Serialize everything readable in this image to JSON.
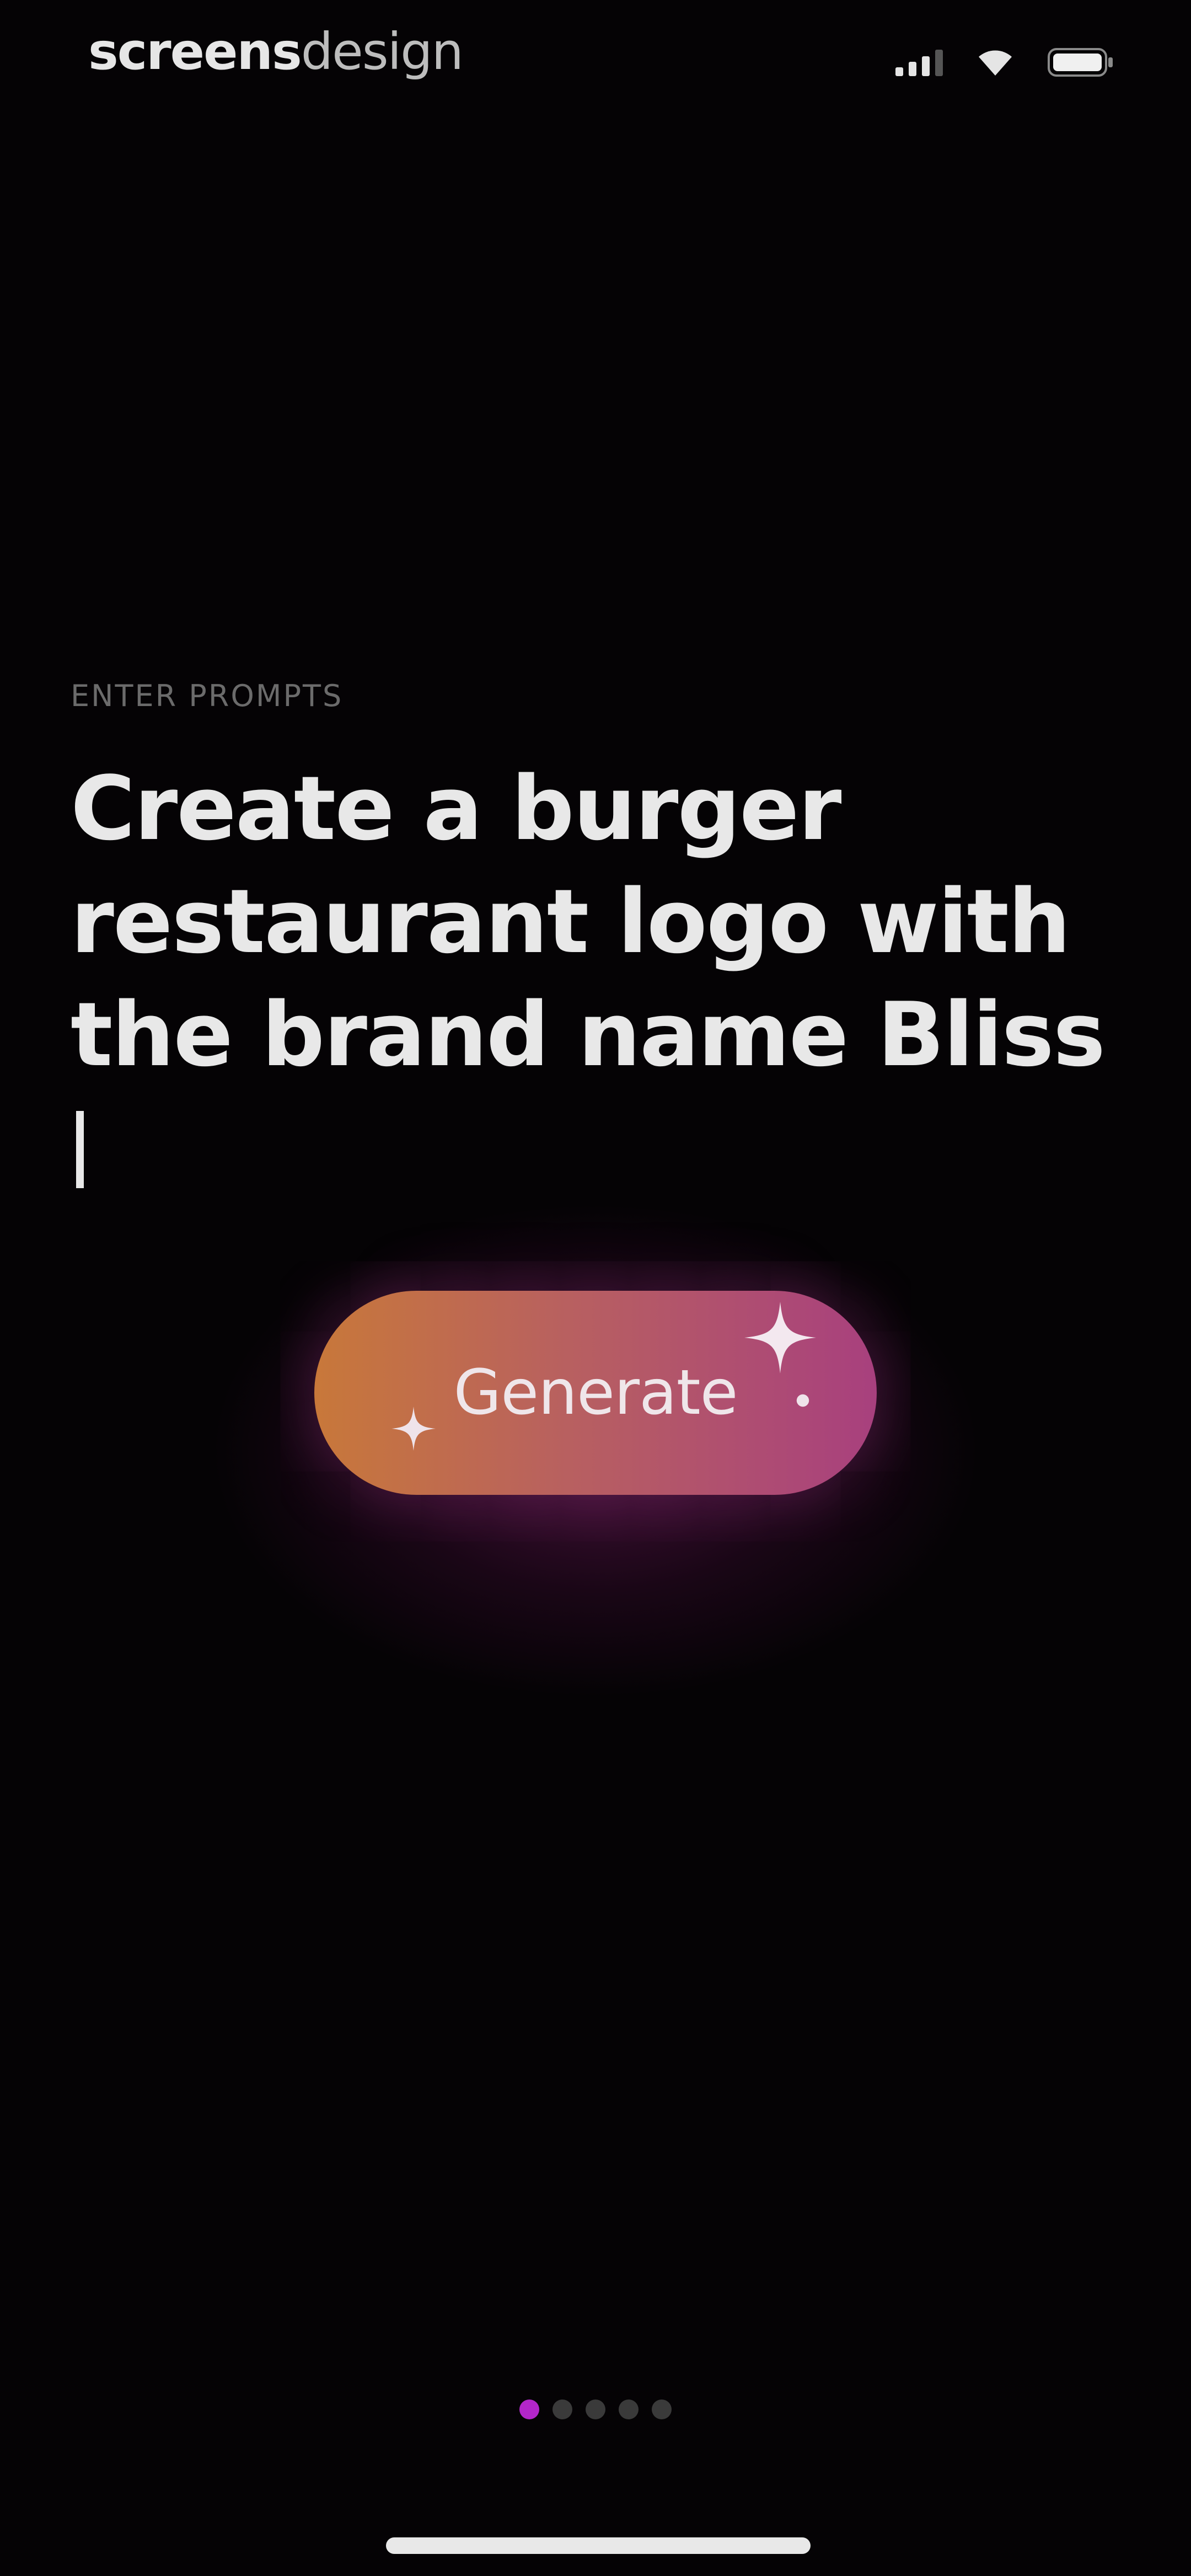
{
  "status_bar": {
    "brand_bold": "screens",
    "brand_light": "design",
    "icons": [
      "signal-icon",
      "wifi-icon",
      "battery-icon"
    ]
  },
  "prompt": {
    "label": "ENTER PROMPTS",
    "text": "Create a burger restaurant logo with the brand name Bliss"
  },
  "generate_button": {
    "label": "Generate",
    "gradient": [
      "#c8783a",
      "#a8407e"
    ]
  },
  "pagination": {
    "total": 5,
    "current": 1,
    "active_color": "#b326c9"
  },
  "colors": {
    "background": "#050305",
    "text": "#e8e8e8"
  }
}
